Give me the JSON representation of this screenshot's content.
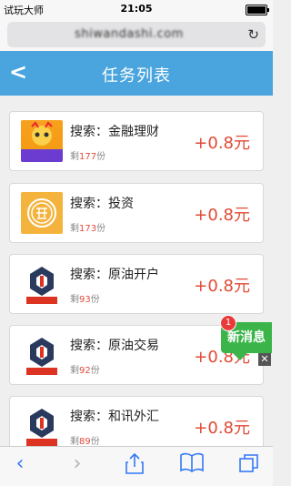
{
  "status_bar": {
    "carrier": "试玩大师",
    "time": "21:05"
  },
  "browser": {
    "url": "shiwandashi.com"
  },
  "header": {
    "title": "任务列表"
  },
  "tasks": [
    {
      "keyword": "搜索：金融理财",
      "remaining_prefix": "剩",
      "remaining": "177",
      "remaining_suffix": "份",
      "reward": "+0.8元",
      "thumb_label": "福宝贝"
    },
    {
      "keyword": "搜索：投资",
      "remaining_prefix": "剩",
      "remaining": "173",
      "remaining_suffix": "份",
      "reward": "+0.8元"
    },
    {
      "keyword": "搜索：原油开户",
      "remaining_prefix": "剩",
      "remaining": "93",
      "remaining_suffix": "份",
      "reward": "+0.8元",
      "thumb_label": "现金红包"
    },
    {
      "keyword": "搜索：原油交易",
      "remaining_prefix": "剩",
      "remaining": "92",
      "remaining_suffix": "份",
      "reward": "+0.8元",
      "thumb_label": "现金红包"
    },
    {
      "keyword": "搜索：和讯外汇",
      "remaining_prefix": "剩",
      "remaining": "89",
      "remaining_suffix": "份",
      "reward": "+0.8元",
      "thumb_label": "现金红包"
    }
  ],
  "floating": {
    "label": "新消息",
    "badge": "1",
    "close": "✕"
  }
}
